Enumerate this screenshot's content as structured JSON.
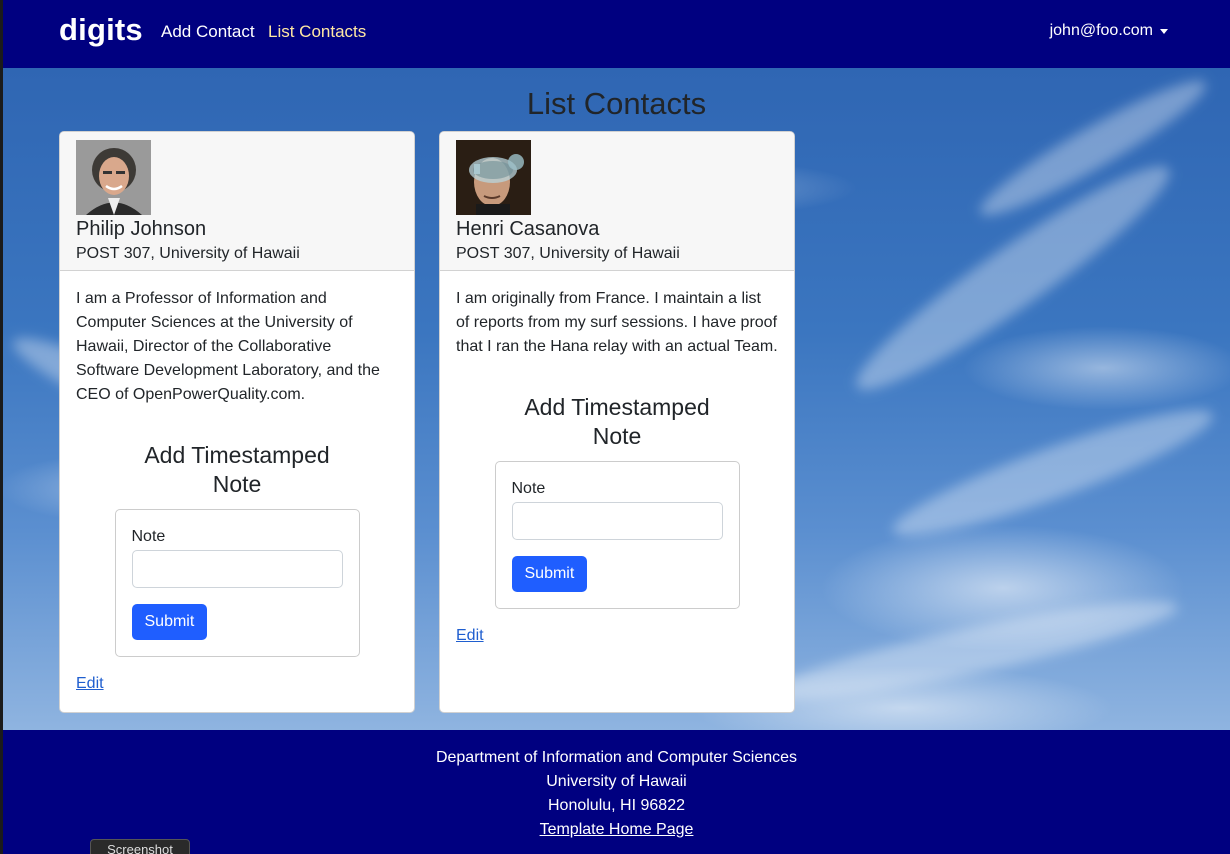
{
  "navbar": {
    "brand": "digits",
    "links": [
      {
        "label": "Add Contact",
        "active": false
      },
      {
        "label": "List Contacts",
        "active": true
      }
    ],
    "user": "john@foo.com"
  },
  "page": {
    "title": "List Contacts"
  },
  "contacts": [
    {
      "name": "Philip Johnson",
      "address": "POST 307, University of Hawaii",
      "description": "I am a Professor of Information and Computer Sciences at the University of Hawaii, Director of the Collaborative Software Development Laboratory, and the CEO of OpenPowerQuality.com.",
      "note_section_title": "Add Timestamped Note",
      "note_label": "Note",
      "note_value": "",
      "submit_label": "Submit",
      "edit_label": "Edit"
    },
    {
      "name": "Henri Casanova",
      "address": "POST 307, University of Hawaii",
      "description": "I am originally from France. I maintain a list of reports from my surf sessions. I have proof that I ran the Hana relay with an actual Team.",
      "note_section_title": "Add Timestamped Note",
      "note_label": "Note",
      "note_value": "",
      "submit_label": "Submit",
      "edit_label": "Edit"
    }
  ],
  "footer": {
    "line1": "Department of Information and Computer Sciences",
    "line2": "University of Hawaii",
    "line3": "Honolulu, HI 96822",
    "link_label": "Template Home Page"
  },
  "overlay": {
    "screenshot_label": "Screenshot"
  },
  "colors": {
    "navbar_bg": "#000080",
    "active_link": "#ffe8a3",
    "primary_button": "#1f5eff",
    "link": "#1f5ecf"
  }
}
